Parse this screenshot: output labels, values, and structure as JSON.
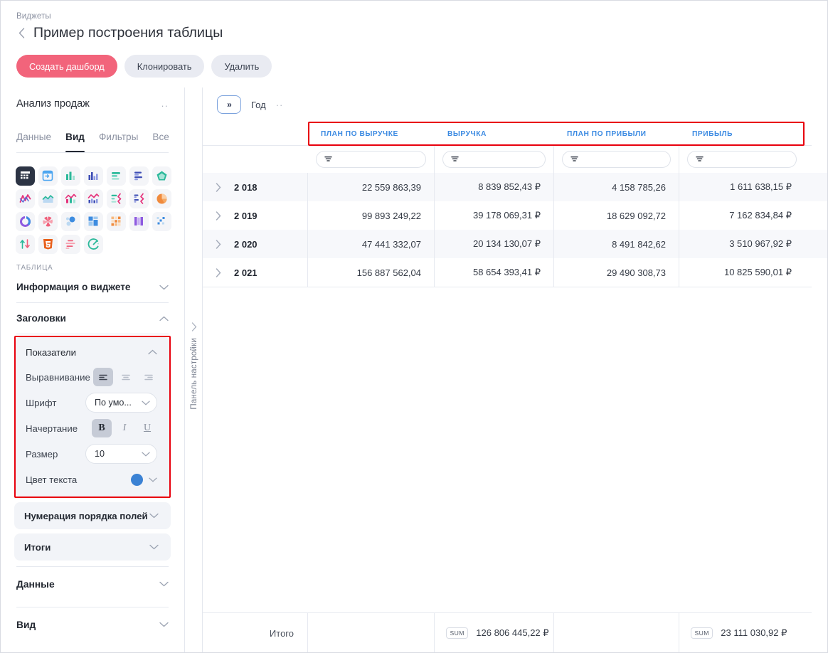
{
  "header": {
    "breadcrumb": "Виджеты",
    "title": "Пример построения таблицы",
    "buttons": {
      "create_dashboard": "Создать дашборд",
      "clone": "Клонировать",
      "delete": "Удалить"
    }
  },
  "sidebar": {
    "dataset_name": "Анализ продаж",
    "dots": "··",
    "tabs": [
      {
        "label": "Данные",
        "active": false
      },
      {
        "label": "Вид",
        "active": true
      },
      {
        "label": "Фильтры",
        "active": false
      },
      {
        "label": "Все",
        "active": false
      }
    ],
    "chart_icons": [
      "table-icon",
      "pivot-table-icon",
      "bar-vertical-icon",
      "bar-grouped-icon",
      "bar-horizontal-icon",
      "bar-horizontal-grouped-icon",
      "area-polygon-icon",
      "line-icon",
      "area-line-icon",
      "combo-bar-line-icon",
      "combo-multi-icon",
      "bar-line-horizontal-icon",
      "bar-line-horizontal-grouped-icon",
      "pie-icon",
      "donut-progress-icon",
      "radar-icon",
      "bubble-icon",
      "treemap-icon",
      "heatmap-icon",
      "funnel-vertical-icon",
      "scatter-icon",
      "updown-arrows-icon",
      "html-icon",
      "bullet-chart-icon",
      "gauge-icon"
    ],
    "section_caption": "ТАБЛИЦА",
    "widget_info": "Информация о виджете",
    "headers_section": "Заголовки",
    "indicators": {
      "title": "Показатели",
      "alignment_label": "Выравнивание",
      "font_label": "Шрифт",
      "font_value": "По умо...",
      "style_label": "Начертание",
      "style_bold": "B",
      "style_italic": "I",
      "style_underline": "U",
      "size_label": "Размер",
      "size_value": "10",
      "color_label": "Цвет текста",
      "color_value": "#3b82d4"
    },
    "field_numbering": "Нумерация порядка полей",
    "totals_section": "Итоги",
    "data_section": "Данные",
    "view_section": "Вид"
  },
  "panel_tab": {
    "label": "Панель настройки"
  },
  "main": {
    "toolbar": {
      "expand_label": "»",
      "dimension": "Год",
      "dots": "··"
    },
    "table": {
      "columns": [
        "ПЛАН ПО ВЫРУЧКЕ",
        "ВЫРУЧКА",
        "ПЛАН ПО ПРИБЫЛИ",
        "ПРИБЫЛЬ"
      ],
      "rows": [
        {
          "label": "2 018",
          "values": [
            "22 559 863,39",
            "8 839 852,43 ₽",
            "4 158 785,26",
            "1 611 638,15 ₽"
          ]
        },
        {
          "label": "2 019",
          "values": [
            "99 893 249,22",
            "39 178 069,31 ₽",
            "18 629 092,72",
            "7 162 834,84 ₽"
          ]
        },
        {
          "label": "2 020",
          "values": [
            "47 441 332,07",
            "20 134 130,07 ₽",
            "8 491 842,62",
            "3 510 967,92 ₽"
          ]
        },
        {
          "label": "2 021",
          "values": [
            "156 887 562,04",
            "58 654 393,41 ₽",
            "29 490 308,73",
            "10 825 590,01 ₽"
          ]
        }
      ],
      "totals": {
        "label": "Итого",
        "cells": [
          {
            "badge": "",
            "value": ""
          },
          {
            "badge": "SUM",
            "value": "126 806 445,22 ₽"
          },
          {
            "badge": "",
            "value": ""
          },
          {
            "badge": "SUM",
            "value": "23 111 030,92 ₽"
          }
        ]
      }
    }
  },
  "colors": {
    "accent_pink": "#f2647b",
    "highlight_red": "#e8000d",
    "header_blue": "#3b8ae2",
    "text_color_swatch": "#3b82d4"
  }
}
